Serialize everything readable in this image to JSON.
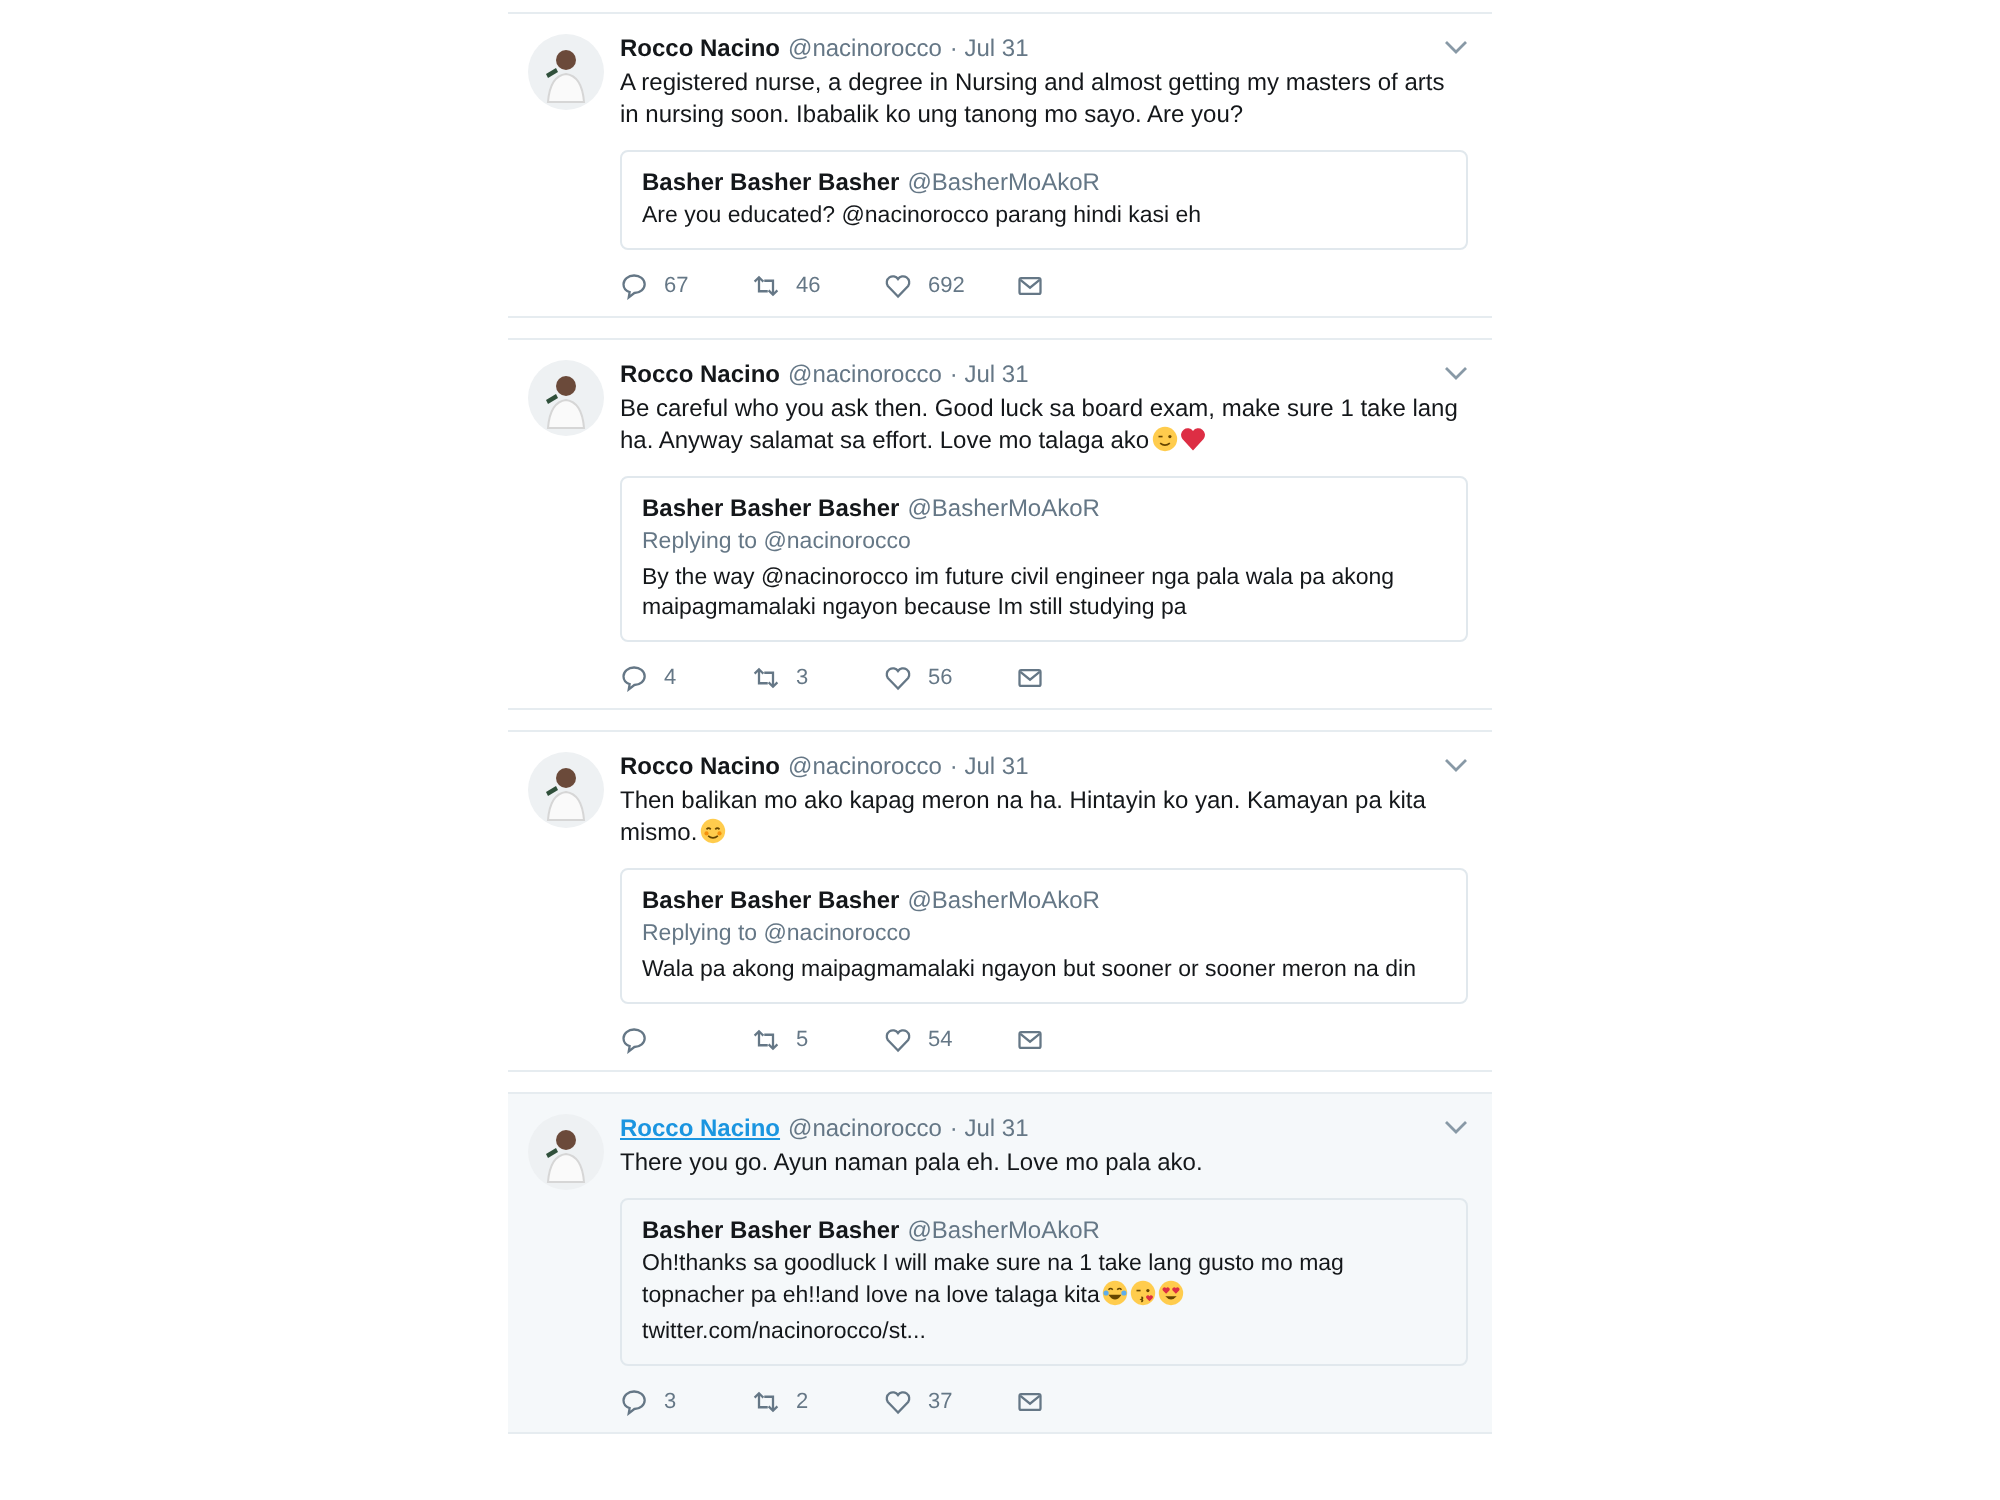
{
  "tweets": [
    {
      "name": "Rocco Nacino",
      "handle": "@nacinorocco",
      "time": "· Jul 31",
      "hovered": false,
      "text": "A registered nurse, a degree in Nursing and almost getting my masters of arts in nursing soon. Ibabalik ko ung tanong mo sayo. Are you?",
      "quote": {
        "name": "Basher Basher Basher",
        "handle": "@BasherMoAkoR",
        "text": "Are you educated? @nacinorocco parang hindi kasi eh"
      },
      "replies": "67",
      "retweets": "46",
      "likes": "692"
    },
    {
      "name": "Rocco Nacino",
      "handle": "@nacinorocco",
      "time": "· Jul 31",
      "hovered": false,
      "text": "Be careful who you ask then. Good luck sa board exam, make sure 1 take lang ha. Anyway salamat sa effort. Love mo talaga ako",
      "emojis": [
        {
          "kind": "wink"
        },
        {
          "kind": "heart"
        }
      ],
      "quote": {
        "name": "Basher Basher Basher",
        "handle": "@BasherMoAkoR",
        "replying_to": "Replying to @nacinorocco",
        "text": "By the way @nacinorocco im future civil engineer nga pala wala pa akong maipagmamalaki ngayon because Im still studying pa"
      },
      "replies": "4",
      "retweets": "3",
      "likes": "56"
    },
    {
      "name": "Rocco Nacino",
      "handle": "@nacinorocco",
      "time": "· Jul 31",
      "hovered": false,
      "text": "Then balikan mo ako kapag meron na ha. Hintayin ko yan. Kamayan pa kita mismo.",
      "emojis": [
        {
          "kind": "blush"
        }
      ],
      "quote": {
        "name": "Basher Basher Basher",
        "handle": "@BasherMoAkoR",
        "replying_to": "Replying to @nacinorocco",
        "text": "Wala pa akong maipagmamalaki ngayon but sooner or sooner meron na din"
      },
      "retweets": "5",
      "likes": "54"
    },
    {
      "name": "Rocco Nacino",
      "handle": "@nacinorocco",
      "time": "· Jul 31",
      "hovered": true,
      "text": "There you go. Ayun naman pala eh. Love mo pala ako.",
      "quote": {
        "name": "Basher Basher Basher",
        "handle": "@BasherMoAkoR",
        "text": "Oh!thanks sa goodluck I will make sure na 1 take lang gusto mo mag topnacher pa eh!!and love na love talaga kita",
        "emojis": [
          {
            "kind": "laugh"
          },
          {
            "kind": "kiss"
          },
          {
            "kind": "hearteyes"
          }
        ],
        "link": "twitter.com/nacinorocco/st..."
      },
      "replies": "3",
      "retweets": "2",
      "likes": "37"
    }
  ]
}
